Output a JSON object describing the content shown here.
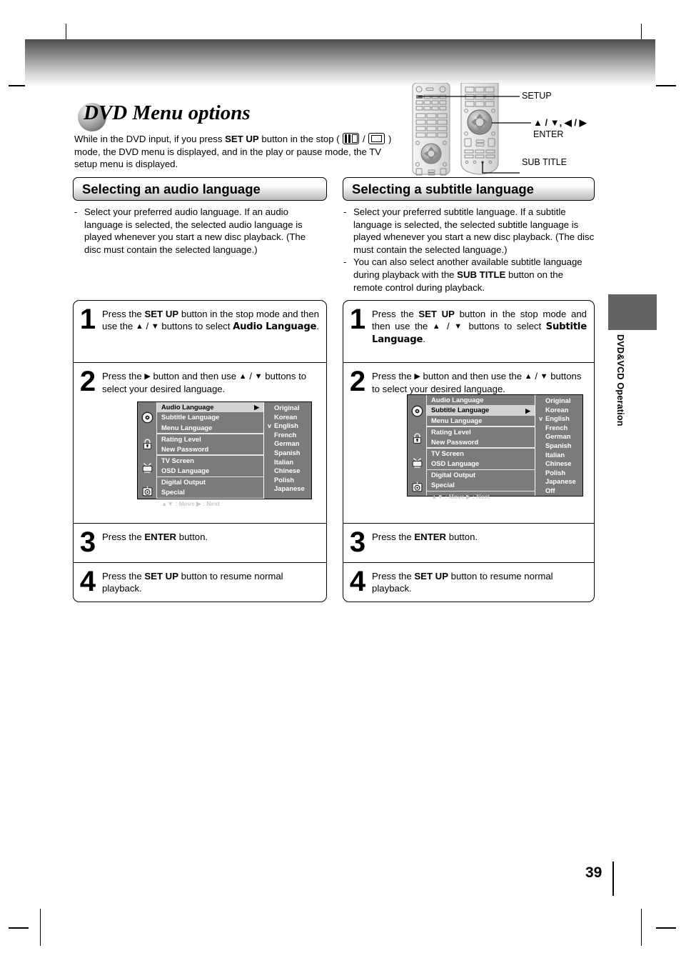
{
  "page": {
    "number": "39",
    "side_tab_label": "DVD&VCD Operation"
  },
  "title": {
    "text": "DVD Menu options",
    "intro_pre": "While in the DVD input, if you press ",
    "intro_setup": "SET UP",
    "intro_mid": " button in the stop ( ",
    "intro_slash": " / ",
    "intro_post": " ) mode, the DVD menu is displayed, and in the play or pause mode, the TV setup menu is displayed.",
    "icon_pause": "pause-icon",
    "icon_stop": "stop-icon"
  },
  "remote_callouts": [
    {
      "label": "SETUP",
      "name": "callout-setup"
    },
    {
      "label": "▲ / ▼, ◀ / ▶",
      "name": "callout-dpad"
    },
    {
      "label": "ENTER",
      "name": "callout-enter"
    },
    {
      "label": "SUB TITLE",
      "name": "callout-subtitle"
    }
  ],
  "audio_section": {
    "header": "Selecting an audio language",
    "bullets": [
      {
        "dash": "-",
        "text": "Select your preferred audio language. If an audio language is selected, the selected audio language is played whenever you start a new disc playback. (The disc must contain the selected language.)"
      }
    ],
    "steps": [
      {
        "num": "1",
        "pre": "Press the ",
        "b1": "SET UP",
        "mid1": " button in the stop mode and then use the ",
        "up": "▲",
        "slash": " / ",
        "down": "▼",
        "mid2": " buttons to select ",
        "b2": "Audio Language",
        "post": "."
      },
      {
        "num": "2",
        "pre": "Press the ",
        "right": "▶",
        "mid1": " button and then use ",
        "up": "▲",
        "slash": " / ",
        "down": "▼",
        "mid2": " buttons to select your desired language.",
        "post": ""
      },
      {
        "num": "3",
        "pre": "Press the  ",
        "b1": "ENTER",
        "mid1": " button.",
        "post": ""
      },
      {
        "num": "4",
        "pre": "Press the  ",
        "b1": "SET UP",
        "mid1": " button to resume normal playback.",
        "post": ""
      }
    ],
    "osd": {
      "menu_items": [
        {
          "label": "Audio Language",
          "selected": true,
          "arrow": "▶"
        },
        {
          "label": "Subtitle Language",
          "selected": false
        },
        {
          "label": "Menu Language",
          "selected": false
        },
        {
          "label": "Rating Level",
          "selected": false
        },
        {
          "label": "New Password",
          "selected": false
        },
        {
          "label": "TV Screen",
          "selected": false
        },
        {
          "label": "OSD Language",
          "selected": false
        },
        {
          "label": "Digital Output",
          "selected": false
        },
        {
          "label": "Special",
          "selected": false
        }
      ],
      "footer": "▲▼ : Move    ▶ : Next",
      "icons": [
        "disc-icon",
        "lock-icon",
        "tv-icon",
        "digital-output-icon"
      ],
      "options": [
        {
          "label": "Original",
          "checked": false
        },
        {
          "label": "Korean",
          "checked": false
        },
        {
          "label": "English",
          "checked": true
        },
        {
          "label": "French",
          "checked": false
        },
        {
          "label": "German",
          "checked": false
        },
        {
          "label": "Spanish",
          "checked": false
        },
        {
          "label": "Italian",
          "checked": false
        },
        {
          "label": "Chinese",
          "checked": false
        },
        {
          "label": "Polish",
          "checked": false
        },
        {
          "label": "Japanese",
          "checked": false
        }
      ],
      "check_mark": "v"
    }
  },
  "subtitle_section": {
    "header": "Selecting a subtitle language",
    "bullets": [
      {
        "dash": "-",
        "text": "Select your preferred subtitle language. If a subtitle language is selected, the selected subtitle language is played whenever you start a new disc playback. (The disc must contain the selected language.)"
      },
      {
        "dash": "-",
        "text_pre": "You can also select another available subtitle language during playback with the ",
        "text_bold": "SUB TITLE",
        "text_post": " button on the remote control during playback."
      }
    ],
    "steps": [
      {
        "num": "1",
        "pre": "Press the ",
        "b1": "SET UP",
        "mid1": " button in the stop mode and then use the ",
        "up": "▲",
        "slash": " / ",
        "down": "▼",
        "mid2": " buttons to select ",
        "b2": "Subtitle Language",
        "post": "."
      },
      {
        "num": "2",
        "pre": "Press the ",
        "right": "▶",
        "mid1": " button and then use the ",
        "up": "▲",
        "slash": " / ",
        "down": "▼",
        "mid2": " buttons to select your desired language.",
        "post": ""
      },
      {
        "num": "3",
        "pre": "Press the ",
        "b1": "ENTER",
        "mid1": " button.",
        "post": ""
      },
      {
        "num": "4",
        "pre": "Press the ",
        "b1": "SET UP",
        "mid1": " button to resume normal playback.",
        "post": ""
      }
    ],
    "osd": {
      "menu_items": [
        {
          "label": "Audio Language",
          "selected": false
        },
        {
          "label": "Subtitle Language",
          "selected": true,
          "arrow": "▶"
        },
        {
          "label": "Menu Language",
          "selected": false
        },
        {
          "label": "Rating Level",
          "selected": false
        },
        {
          "label": "New Password",
          "selected": false
        },
        {
          "label": "TV Screen",
          "selected": false
        },
        {
          "label": "OSD Language",
          "selected": false
        },
        {
          "label": "Digital Output",
          "selected": false
        },
        {
          "label": "Special",
          "selected": false
        }
      ],
      "footer": "▲▼ : Move    ▶ : Next",
      "icons": [
        "disc-icon",
        "lock-icon",
        "tv-icon",
        "digital-output-icon"
      ],
      "options": [
        {
          "label": "Original",
          "checked": false
        },
        {
          "label": "Korean",
          "checked": false
        },
        {
          "label": "English",
          "checked": true
        },
        {
          "label": "French",
          "checked": false
        },
        {
          "label": "German",
          "checked": false
        },
        {
          "label": "Spanish",
          "checked": false
        },
        {
          "label": "Italian",
          "checked": false
        },
        {
          "label": "Chinese",
          "checked": false
        },
        {
          "label": "Polish",
          "checked": false
        },
        {
          "label": "Japanese",
          "checked": false
        },
        {
          "label": "Off",
          "checked": false
        }
      ],
      "check_mark": "v"
    }
  },
  "colors": {
    "osd_background": "#7b7b7b",
    "osd_selected": "#d2d2d2",
    "side_tab": "#636363",
    "text": "#000000"
  }
}
